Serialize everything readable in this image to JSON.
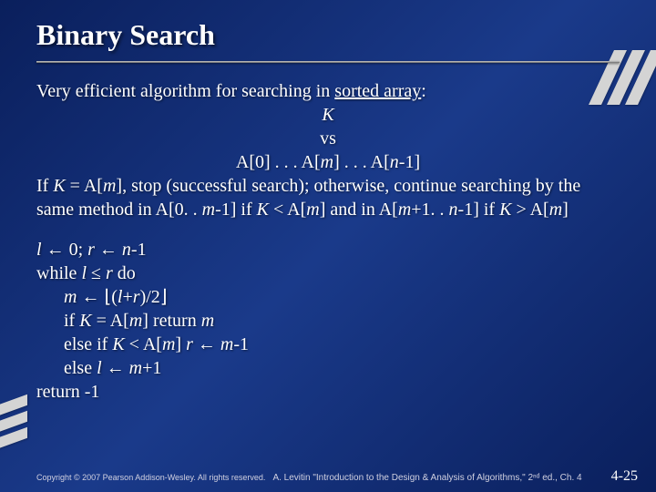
{
  "title": "Binary Search",
  "intro": "Very efficient algorithm for searching in ",
  "intro_underline": "sorted array",
  "intro_colon": ":",
  "line_k": "K",
  "line_vs": "vs",
  "array_line": {
    "a0": "A[0]  .  .  .  A[",
    "m": "m",
    "mid": "]  .  .  .  A[",
    "n": "n",
    "end": "-1]"
  },
  "para1a": "If ",
  "para1b": "K",
  "para1c": " = A[",
  "para1d": "m",
  "para1e": "], stop (successful search);  otherwise, continue searching by the same method in A[0. . ",
  "para1f": "m",
  "para1g": "-1] if ",
  "para1h": "K",
  "para1i": " < A[",
  "para1j": "m",
  "para1k": "] and in A[",
  "para1l": "m",
  "para1m": "+1. . ",
  "para1n": "n",
  "para1o": "-1] if ",
  "para1p": "K",
  "para1q": " > A[",
  "para1r": "m",
  "para1s": "]",
  "alg": {
    "l1a": "l",
    "l1b": " ← 0;   ",
    "l1c": "r",
    "l1d": " ← ",
    "l1e": "n",
    "l1f": "-1",
    "l2a": "while ",
    "l2b": "l",
    "l2c": " ≤ ",
    "l2d": "r",
    "l2e": " do",
    "l3a": "m",
    "l3b": " ← ⌊(",
    "l3c": "l",
    "l3d": "+",
    "l3e": "r",
    "l3f": ")/2⌋",
    "l4a": "if  ",
    "l4b": "K",
    "l4c": " = A[",
    "l4d": "m",
    "l4e": "]  return ",
    "l4f": "m",
    "l5a": "else if ",
    "l5b": "K",
    "l5c": " < A[",
    "l5d": "m",
    "l5e": "]  ",
    "l5f": "r",
    "l5g": " ← ",
    "l5h": "m",
    "l5i": "-1",
    "l6a": "else ",
    "l6b": "l",
    "l6c": " ← ",
    "l6d": "m",
    "l6e": "+1",
    "l7": "return -1"
  },
  "footer": {
    "copyright": "Copyright © 2007 Pearson Addison-Wesley. All rights reserved.",
    "book": "A. Levitin \"Introduction to the Design & Analysis of Algorithms,\" 2ⁿᵈ ed., Ch. 4",
    "page": "4-25"
  }
}
